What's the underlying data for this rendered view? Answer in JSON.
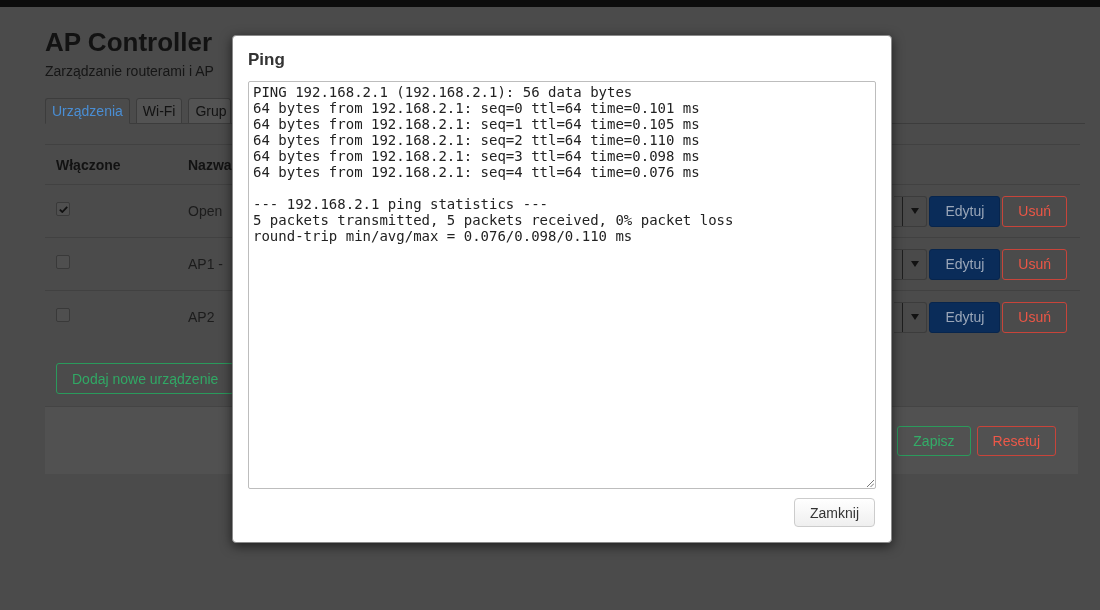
{
  "header": {
    "title": "AP Controller",
    "subtitle": "Zarządzanie routerami i AP"
  },
  "tabs": [
    {
      "label": "Urządzenia",
      "selected": true
    },
    {
      "label": "Wi-Fi",
      "selected": false
    },
    {
      "label": "Grup",
      "selected": false
    }
  ],
  "devices_table": {
    "columns": [
      "Włączone",
      "Nazwa"
    ],
    "rows": [
      {
        "enabled": true,
        "name": "Open",
        "actions": [
          {
            "label": "Edytuj",
            "kind": "edit"
          },
          {
            "label": "Usuń",
            "kind": "delete"
          }
        ]
      },
      {
        "enabled": false,
        "name": "AP1 -",
        "actions": [
          {
            "label": "Edytuj",
            "kind": "edit"
          },
          {
            "label": "Usuń",
            "kind": "delete"
          }
        ]
      },
      {
        "enabled": false,
        "name": "AP2",
        "actions": [
          {
            "label": "Edytuj",
            "kind": "edit"
          },
          {
            "label": "Usuń",
            "kind": "delete"
          }
        ]
      }
    ]
  },
  "add_button": {
    "label": "Dodaj nowe urządzenie",
    "kind": "add"
  },
  "footer_buttons": [
    {
      "label": "Zapisz",
      "kind": "save"
    },
    {
      "label": "Resetuj",
      "kind": "reset"
    }
  ],
  "ping_dialog": {
    "title": "Ping",
    "output": [
      {
        "lines": [
          "PING 192.168.2.1 (192.168.2.1): 56 data bytes",
          "64 bytes from 192.168.2.1: seq=0 ttl=64 time=0.101 ms",
          "64 bytes from 192.168.2.1: seq=1 ttl=64 time=0.105 ms",
          "64 bytes from 192.168.2.1: seq=2 ttl=64 time=0.110 ms",
          "64 bytes from 192.168.2.1: seq=3 ttl=64 time=0.098 ms",
          "64 bytes from 192.168.2.1: seq=4 ttl=64 time=0.076 ms"
        ]
      },
      {
        "lines": [
          "--- 192.168.2.1 ping statistics ---",
          "5 packets transmitted, 5 packets received, 0% packet loss",
          "round-trip min/avg/max = 0.076/0.098/0.110 ms"
        ]
      }
    ],
    "close_button": "Zamknij"
  }
}
